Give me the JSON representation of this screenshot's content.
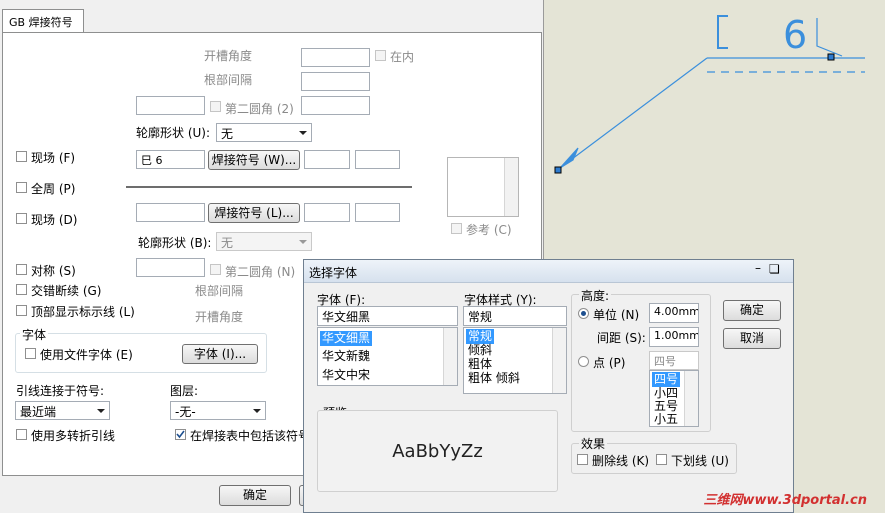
{
  "canvas": {
    "symbol_text": "巳6",
    "watermark": "三维网www.3dportal.cn"
  },
  "weld_dialog": {
    "tab": "GB 焊接符号",
    "groove_angle": "开槽角度",
    "inside": "在内",
    "root_gap": "根部间隔",
    "second_fillet": "第二圆角 (2)",
    "contour_u": "轮廓形状 (U):",
    "contour_u_value": "无",
    "field_top": "现场 (F)",
    "symbol_value": "巳 6",
    "weld_symbol_btn_top": "焊接符号 (W)...",
    "all_around": "全周 (P)",
    "field_bottom": "现场 (D)",
    "weld_symbol_btn_bottom": "焊接符号 (L)...",
    "reference": "参考 (C)",
    "contour_b": "轮廓形状 (B):",
    "contour_b_value": "无",
    "symmetric": "对称 (S)",
    "second_fillet_b": "第二圆角 (N)",
    "staggered": "交错断续 (G)",
    "root_gap_b": "根部间隔",
    "top_display": "顶部显示标示线 (L)",
    "groove_angle_b": "开槽角度",
    "font_group": "字体",
    "use_doc_font": "使用文件字体 (E)",
    "font_btn": "字体 (I)...",
    "leader_attach": "引线连接于符号:",
    "leader_value": "最近端",
    "layer": "图层:",
    "layer_value": "-无-",
    "multi_jog": "使用多转折引线",
    "include_table": "在焊接表中包括该符号",
    "ok": "确定"
  },
  "font_dialog": {
    "title": "选择字体",
    "font_label": "字体 (F):",
    "font_value": "华文细黑",
    "fonts": [
      "华文细黑",
      "华文新魏",
      "华文中宋"
    ],
    "style_label": "字体样式 (Y):",
    "style_value": "常规",
    "styles": [
      "常规",
      "倾斜",
      "粗体",
      "粗体 倾斜"
    ],
    "height_label": "高度:",
    "unit_label": "单位 (N)",
    "unit_value": "4.00mm",
    "spacing_label": "间距 (S):",
    "spacing_value": "1.00mm",
    "point_label": "点 (P)",
    "point_value": "四号",
    "sizes": [
      "四号",
      "小四",
      "五号",
      "小五"
    ],
    "ok": "确定",
    "cancel": "取消",
    "preview_label": "预览",
    "preview_text": "AaBbYyZz",
    "effects_label": "效果",
    "strikeout": "删除线 (K)",
    "underline": "下划线 (U)"
  },
  "colors": {
    "accent": "#3399ff",
    "symbol": "#3b8fdc",
    "watermark": "#d23030"
  }
}
